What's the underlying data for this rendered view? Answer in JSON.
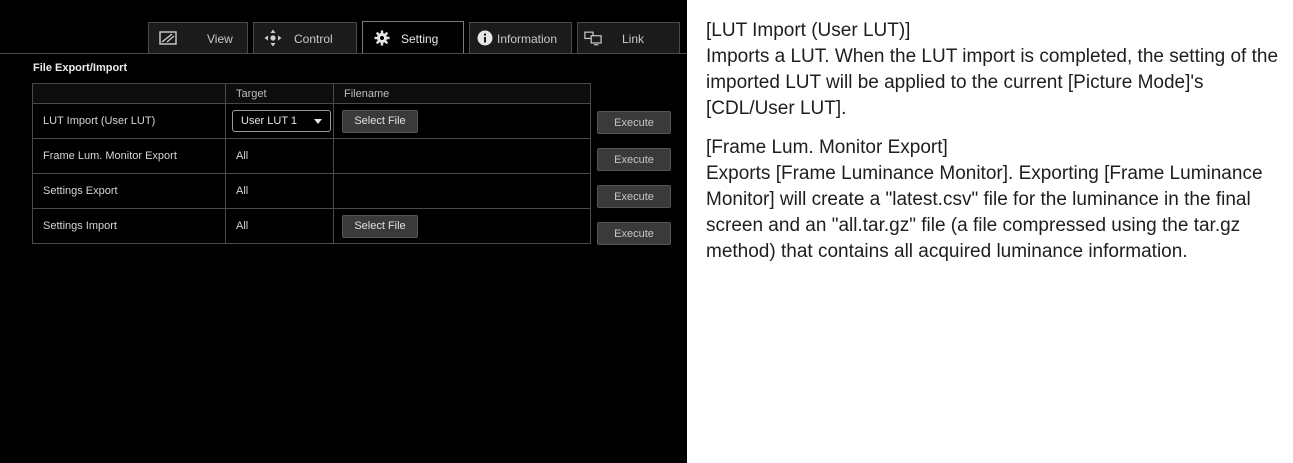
{
  "tabs": [
    {
      "label": "View",
      "icon": "picture-icon"
    },
    {
      "label": "Control",
      "icon": "move-arrows-icon"
    },
    {
      "label": "Setting",
      "icon": "gear-icon"
    },
    {
      "label": "Information",
      "icon": "info-icon"
    },
    {
      "label": "Link",
      "icon": "monitors-link-icon"
    }
  ],
  "active_tab": "Setting",
  "section_title": "File Export/Import",
  "table": {
    "headers": [
      "",
      "Target",
      "Filename"
    ],
    "rows": [
      {
        "name": "LUT Import (User LUT)",
        "target": "User LUT 1",
        "target_is_select": true,
        "file_button": "Select File",
        "action": "Execute"
      },
      {
        "name": "Frame Lum. Monitor Export",
        "target": "All",
        "file_button": "",
        "action": "Execute"
      },
      {
        "name": "Settings Export",
        "target": "All",
        "file_button": "",
        "action": "Execute"
      },
      {
        "name": "Settings Import",
        "target": "All",
        "file_button": "Select File",
        "action": "Execute"
      }
    ]
  },
  "description": {
    "lut_heading": "[LUT Import (User LUT)]",
    "lut_body": "Imports a LUT. When the LUT import is completed, the setting of the imported LUT will be applied to the current [Picture Mode]'s [CDL/User LUT].",
    "frame_heading": "[Frame Lum. Monitor Export]",
    "frame_body": "Exports [Frame Luminance Monitor]. Exporting [Frame Luminance Monitor] will create a \"latest.csv\" file for the luminance in the final screen and an \"all.tar.gz\" file (a file compressed using the tar.gz method) that contains all acquired luminance information."
  },
  "colors": {
    "screen_bg": "#000000",
    "button_bg": "#3a3a3a",
    "border": "#4a4a4a"
  }
}
